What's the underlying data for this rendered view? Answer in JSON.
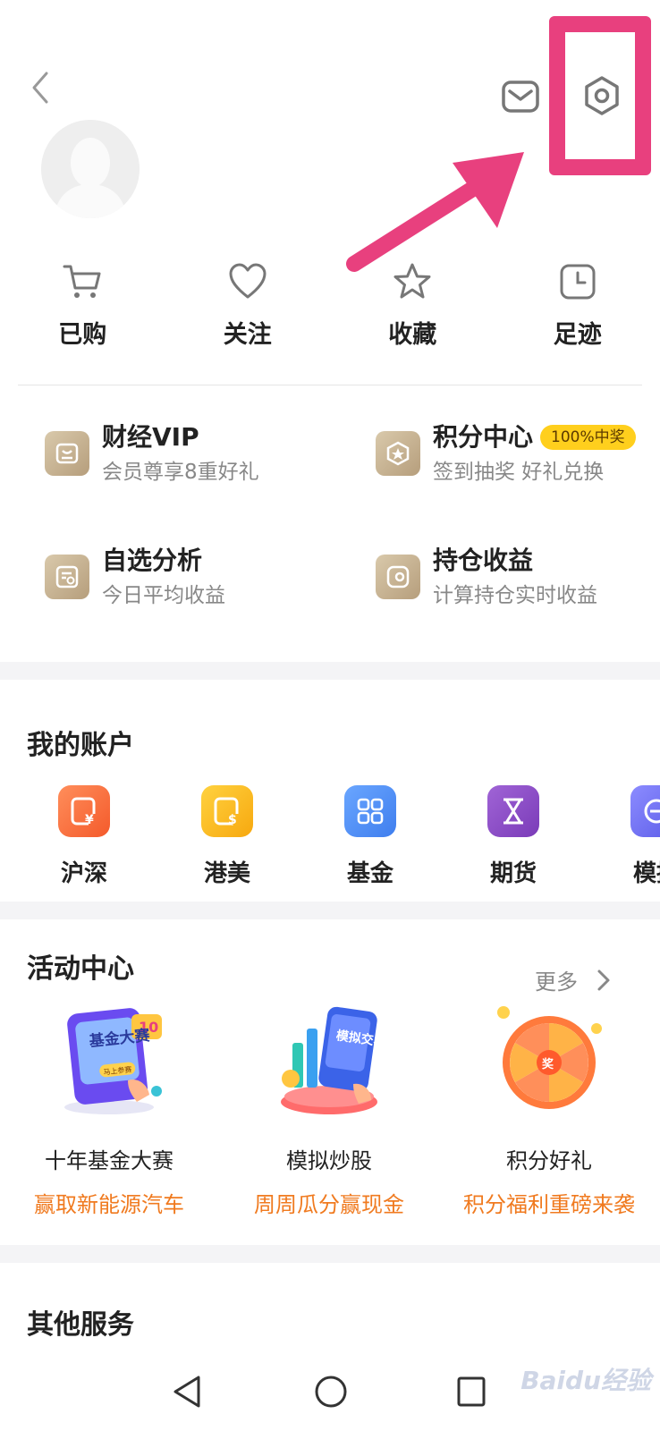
{
  "quick": [
    {
      "label": "已购",
      "icon": "cart-icon"
    },
    {
      "label": "关注",
      "icon": "heart-icon"
    },
    {
      "label": "收藏",
      "icon": "star-icon"
    },
    {
      "label": "足迹",
      "icon": "clock-icon"
    }
  ],
  "features": [
    {
      "title": "财经VIP",
      "sub": "会员尊享8重好礼",
      "icon": "vip-icon"
    },
    {
      "title": "积分中心",
      "badge": "100%中奖",
      "sub": "签到抽奖 好礼兑换",
      "icon": "points-icon"
    },
    {
      "title": "自选分析",
      "sub": "今日平均收益",
      "icon": "analysis-icon"
    },
    {
      "title": "持仓收益",
      "sub": "计算持仓实时收益",
      "icon": "holdings-icon"
    }
  ],
  "accounts": {
    "title": "我的账户",
    "items": [
      {
        "label": "沪深",
        "icon": "yuan-account-icon",
        "color": "#fa6a3b"
      },
      {
        "label": "港美",
        "icon": "dollar-account-icon",
        "color": "#f9b81c"
      },
      {
        "label": "基金",
        "icon": "fund-grid-icon",
        "color": "#4f8ff2"
      },
      {
        "label": "期货",
        "icon": "hourglass-icon",
        "color": "#8a4cc4"
      },
      {
        "label": "模拟",
        "icon": "simulate-icon",
        "color": "#6f6ff0"
      }
    ]
  },
  "activities": {
    "title": "活动中心",
    "more": "更多",
    "items": [
      {
        "title": "十年基金大赛",
        "sub": "赢取新能源汽车",
        "img_text": "基金大赛",
        "tag": "马上参赛",
        "icon": "fund-contest-illustration"
      },
      {
        "title": "模拟炒股",
        "sub": "周周瓜分赢现金",
        "img_text": "模拟交易",
        "icon": "simulated-trading-illustration"
      },
      {
        "title": "积分好礼",
        "sub": "积分福利重磅来袭",
        "img_text": "奖",
        "icon": "prize-wheel-illustration"
      }
    ]
  },
  "other": {
    "title": "其他服务"
  },
  "watermark": "Baidu经验",
  "colors": {
    "highlight": "#e8407e",
    "accent_orange": "#f07a1f",
    "badge": "#ffcf1d"
  }
}
